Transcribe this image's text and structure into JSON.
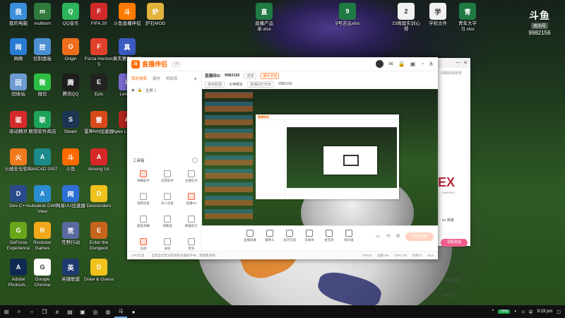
{
  "desktop": {
    "icons": [
      {
        "label": "我的电脑",
        "icon": "computer-icon",
        "color": "#3b8fd9"
      },
      {
        "label": "multisim",
        "icon": "multisim-icon",
        "color": "#2f7a3c"
      },
      {
        "label": "QQ音乐",
        "icon": "qq-music-icon",
        "color": "#2db55d"
      },
      {
        "label": "FIFA 20",
        "icon": "fifa-icon",
        "color": "#d12a2a"
      },
      {
        "label": "斗鱼直播伴侣",
        "icon": "douyu-icon",
        "color": "#ff7a00"
      },
      {
        "label": "炉石MOD",
        "icon": "folder-icon",
        "color": "#e2b23c"
      },
      {
        "label": "网络",
        "icon": "network-icon",
        "color": "#2a7bd4"
      },
      {
        "label": "控制面板",
        "icon": "control-panel-icon",
        "color": "#4a8fd0"
      },
      {
        "label": "Origin",
        "icon": "origin-icon",
        "color": "#f06d1d"
      },
      {
        "label": "Forza Horizon 5",
        "icon": "forza-icon",
        "color": "#e0412a"
      },
      {
        "label": "真实赛车2077",
        "icon": "game-icon",
        "color": "#3a5bbf"
      },
      {
        "label": "回收站",
        "icon": "recycle-bin-icon",
        "color": "#6e9bd2"
      },
      {
        "label": "微信",
        "icon": "wechat-icon",
        "color": "#2dbf44"
      },
      {
        "label": "腾讯QQ",
        "icon": "qq-icon",
        "color": "#1d1d1d"
      },
      {
        "label": "Epic",
        "icon": "epic-icon",
        "color": "#222222"
      },
      {
        "label": "Lenovo",
        "icon": "lenovo-icon",
        "color": "#7a6bd1"
      },
      {
        "label": "驱动精灵",
        "icon": "driver-icon",
        "color": "#d62a2a"
      },
      {
        "label": "联想软件商店",
        "icon": "store-icon",
        "color": "#1ea35a"
      },
      {
        "label": "Steam",
        "icon": "steam-icon",
        "color": "#1b3553"
      },
      {
        "label": "雷神NN加速器",
        "icon": "nn-icon",
        "color": "#d84a1a"
      },
      {
        "label": "Apex Legends",
        "icon": "apex-icon",
        "color": "#b3261e"
      },
      {
        "label": "火绒安全软件",
        "icon": "huorong-icon",
        "color": "#f07b1d"
      },
      {
        "label": "AutoCAD 2007",
        "icon": "autocad-icon",
        "color": "#1c8a8a"
      },
      {
        "label": "斗鱼",
        "icon": "douyu-fish-icon",
        "color": "#ff6a00"
      },
      {
        "label": "Among Us",
        "icon": "among-us-icon",
        "color": "#d62828"
      },
      {
        "label": "Dev-C++",
        "icon": "devcpp-icon",
        "color": "#2a4a8c"
      },
      {
        "label": "Autodesk DWF View",
        "icon": "dwf-icon",
        "color": "#2a8cd0"
      },
      {
        "label": "网易UU加速器",
        "icon": "uu-icon",
        "color": "#2f6fd8"
      },
      {
        "label": "Descenders",
        "icon": "descenders-icon",
        "color": "#f0c21c"
      },
      {
        "label": "GeForce Experience",
        "icon": "geforce-icon",
        "color": "#6aa61c"
      },
      {
        "label": "Rockstar Games",
        "icon": "rockstar-icon",
        "color": "#f2a81b"
      },
      {
        "label": "荒野行动",
        "icon": "game2-icon",
        "color": "#5a6aa0"
      },
      {
        "label": "Enter the Gungeon",
        "icon": "gungeon-icon",
        "color": "#c7641c"
      },
      {
        "label": "Adobe Photosh...",
        "icon": "photoshop-icon",
        "color": "#0f2a52"
      },
      {
        "label": "Google Chrome",
        "icon": "chrome-icon",
        "color": "#ffffff"
      },
      {
        "label": "英雄联盟",
        "icon": "lol-icon",
        "color": "#1e3a6e"
      },
      {
        "label": "Draw & Guess",
        "icon": "draw-guess-icon",
        "color": "#f0c21c"
      },
      {
        "label": "直播产品单.xlsx",
        "icon": "excel-icon",
        "color": "#1f7a43"
      },
      {
        "label": "9号吉云xlsx",
        "icon": "excel-icon",
        "color": "#1f7a43"
      },
      {
        "label": "23周届实训心得",
        "icon": "word-icon",
        "color": "#f2f2f2"
      },
      {
        "label": "学校文件",
        "icon": "doc-icon",
        "color": "#f2f2f2"
      },
      {
        "label": "青年大学习.xlsx",
        "icon": "excel-icon",
        "color": "#1f7a43"
      }
    ]
  },
  "douyu_badge": {
    "mark": "斗鱼",
    "tag": "房间号",
    "room": "9982156"
  },
  "app": {
    "name": "直播伴侣",
    "version": "V6",
    "sidebar": {
      "tabs": [
        "我的场景",
        "素材",
        "帮助库"
      ],
      "scene": "全屏 1",
      "tools_title": "工具箱",
      "tools": [
        {
          "label": "弹幕助手",
          "icon": "danmu-icon",
          "hot": true
        },
        {
          "label": "房管助手",
          "icon": "manager-icon",
          "hot": false
        },
        {
          "label": "主播任务",
          "icon": "task-icon",
          "hot": false
        },
        {
          "label": "视频连麦",
          "icon": "video-link-icon",
          "hot": false
        },
        {
          "label": "多人连麦",
          "icon": "multi-link-icon",
          "hot": false
        },
        {
          "label": "直播PK",
          "icon": "pk-icon",
          "hot": true
        },
        {
          "label": "超级弹幕",
          "icon": "super-danmu-icon",
          "hot": false
        },
        {
          "label": "弹幕墙",
          "icon": "wall-icon",
          "hot": false
        },
        {
          "label": "数据统计",
          "icon": "stats-icon",
          "hot": false
        },
        {
          "label": "美颜",
          "icon": "beauty-icon",
          "hot": true
        },
        {
          "label": "录屏",
          "icon": "record-icon",
          "hot": false
        },
        {
          "label": "更多",
          "icon": "more-icon",
          "hot": false
        }
      ]
    },
    "header": {
      "room_title": "直播间ID",
      "room_id": "9982156",
      "pill1": "选择",
      "chip": "娱乐天地",
      "line2": [
        "游戏联盟",
        "大神赛车",
        "直播间已开启",
        "9982156"
      ]
    },
    "controls": [
      {
        "label": "直播屏幕",
        "icon": "screen-icon"
      },
      {
        "label": "摄像头",
        "icon": "camera-icon"
      },
      {
        "label": "多开区域",
        "icon": "region-icon"
      },
      {
        "label": "多媒体",
        "icon": "media-icon"
      },
      {
        "label": "麦克风",
        "icon": "mic-icon"
      },
      {
        "label": "扬声器",
        "icon": "speaker-icon"
      }
    ],
    "start_button": "开始直播",
    "status": {
      "left": "CPU信息",
      "notice": "当前显示无法检测到主播的手中，请使用录制",
      "right": [
        "FPS:0",
        "丢帧:0%",
        "CPU:7%",
        "码率:0",
        "0K/s"
      ]
    }
  },
  "bgwin": {
    "top_text": "问题反馈有奖",
    "logo": "EX",
    "sub": "RANKING",
    "link": "ex 英雄",
    "button": "领取奖励",
    "line1": "万里正营道具",
    "line2": "申请公司"
  },
  "taskbar": {
    "items": [
      "windows-icon",
      "search-icon",
      "cortana-icon",
      "task-view-icon",
      "edge-icon",
      "explorer-icon",
      "store-icon",
      "chrome-icon",
      "steam-icon",
      "douyu-icon",
      "obs-icon"
    ],
    "tray": {
      "lang": "中",
      "battery": "70%",
      "time": "9:19 pm"
    }
  }
}
